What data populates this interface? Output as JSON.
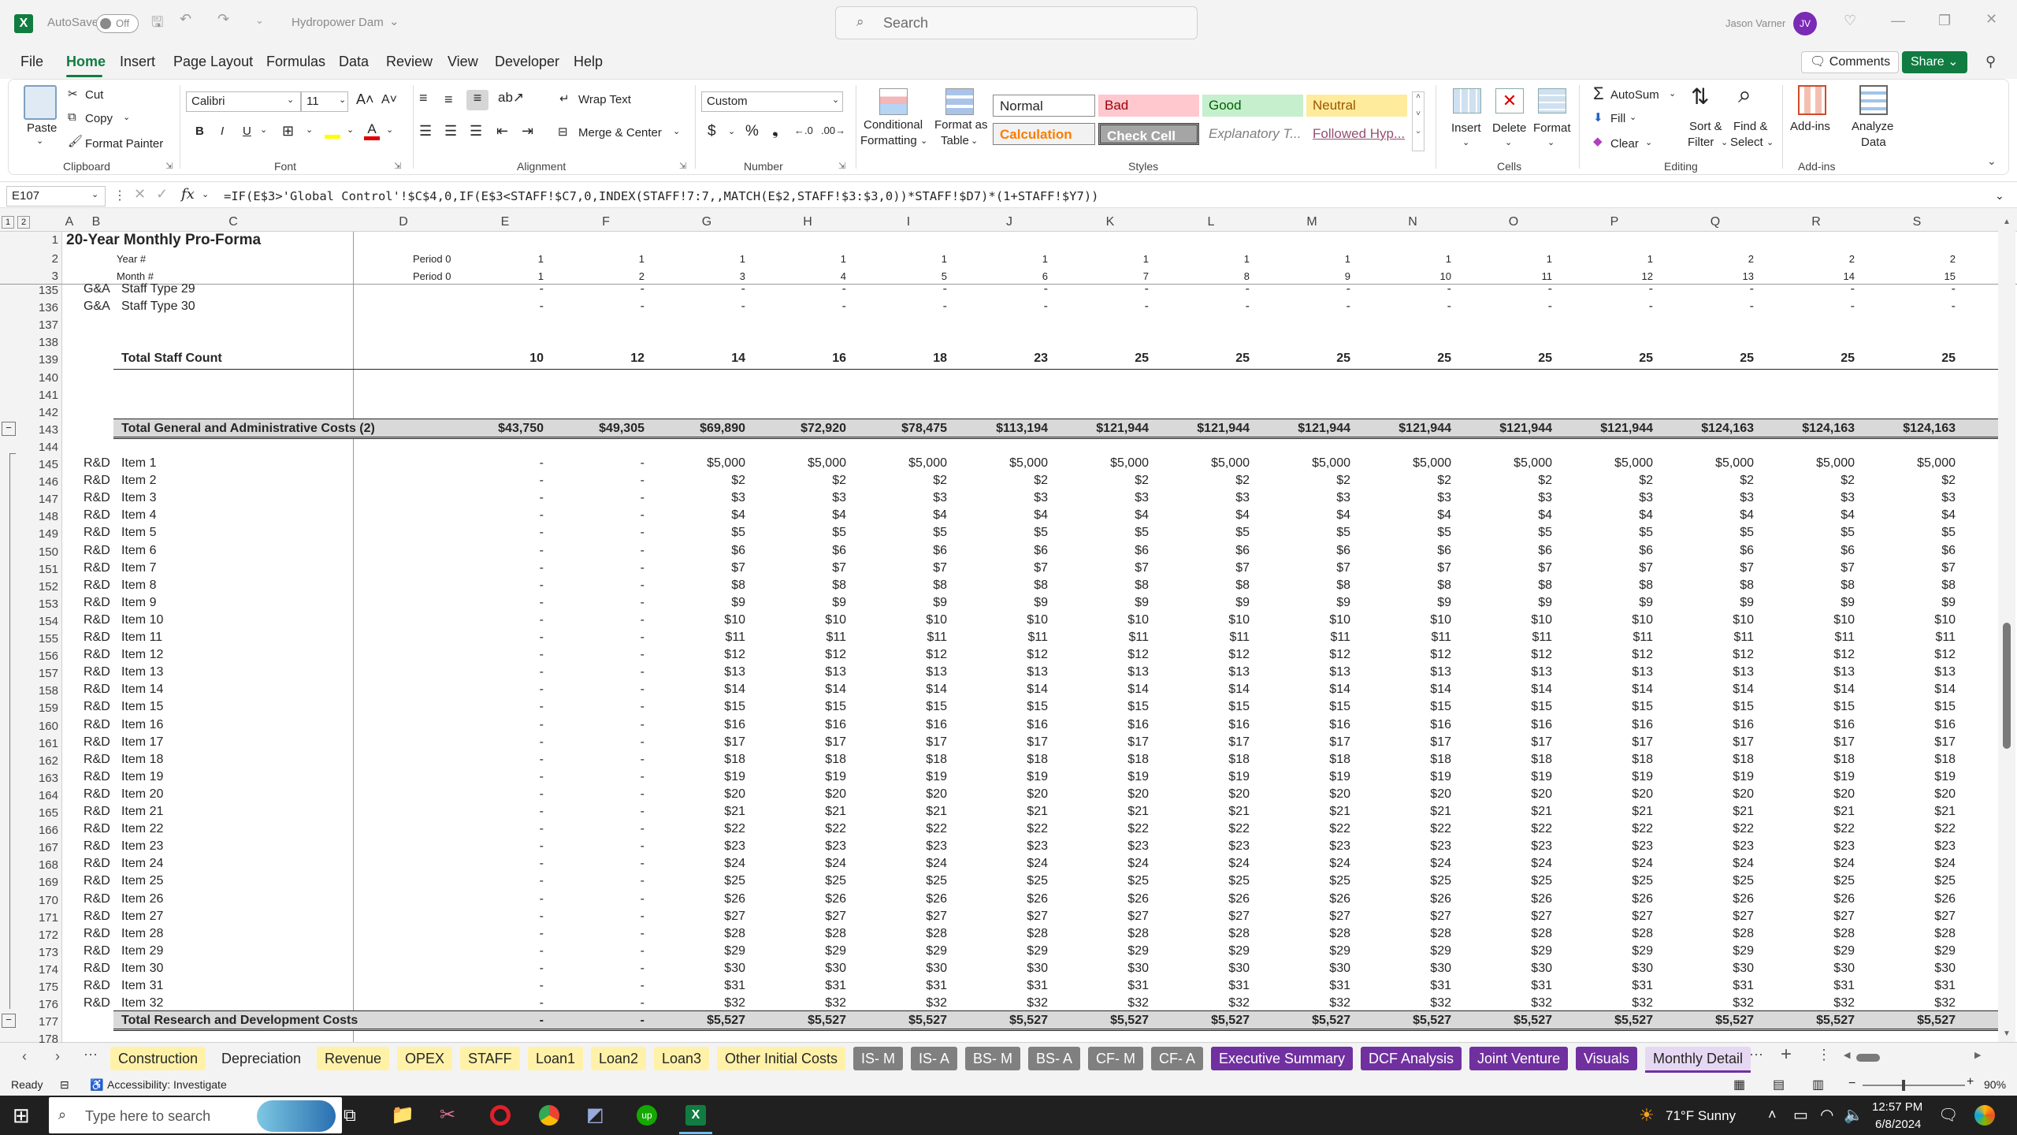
{
  "titlebar": {
    "autosave_label": "AutoSave",
    "autosave_state": "Off",
    "document_title": "Hydropower Dam",
    "search_placeholder": "Search",
    "user_name": "Jason Varner",
    "user_initials": "JV"
  },
  "menu": {
    "file": "File",
    "home": "Home",
    "insert": "Insert",
    "page_layout": "Page Layout",
    "formulas": "Formulas",
    "data": "Data",
    "review": "Review",
    "view": "View",
    "developer": "Developer",
    "help": "Help",
    "comments": "Comments",
    "share": "Share"
  },
  "ribbon": {
    "clipboard": {
      "paste": "Paste",
      "cut": "Cut",
      "copy": "Copy",
      "format_painter": "Format Painter",
      "label": "Clipboard"
    },
    "font": {
      "name": "Calibri",
      "size": "11",
      "label": "Font"
    },
    "alignment": {
      "wrap_text": "Wrap Text",
      "merge_center": "Merge & Center",
      "label": "Alignment"
    },
    "number": {
      "format": "Custom",
      "label": "Number"
    },
    "styles": {
      "conditional_formatting_1": "Conditional",
      "conditional_formatting_2": "Formatting",
      "format_as_table_1": "Format as",
      "format_as_table_2": "Table",
      "normal": "Normal",
      "bad": "Bad",
      "good": "Good",
      "neutral": "Neutral",
      "calculation": "Calculation",
      "check_cell": "Check Cell",
      "explanatory": "Explanatory T...",
      "followed": "Followed Hyp...",
      "label": "Styles"
    },
    "cells": {
      "insert": "Insert",
      "delete": "Delete",
      "format": "Format",
      "label": "Cells"
    },
    "editing": {
      "autosum": "AutoSum",
      "fill": "Fill",
      "clear": "Clear",
      "sort_filter_1": "Sort &",
      "sort_filter_2": "Filter",
      "find_select_1": "Find &",
      "find_select_2": "Select",
      "label": "Editing"
    },
    "addins": {
      "addins": "Add-ins",
      "analyze_1": "Analyze",
      "analyze_2": "Data",
      "label": "Add-ins"
    }
  },
  "formula_bar": {
    "name_box": "E107",
    "formula": "=IF(E$3>'Global Control'!$C$4,0,IF(E$3<STAFF!$C7,0,INDEX(STAFF!7:7,,MATCH(E$2,STAFF!$3:$3,0))*STAFF!$D7)*(1+STAFF!$Y7))"
  },
  "grid": {
    "columns": [
      "A",
      "B",
      "C",
      "D",
      "E",
      "F",
      "G",
      "H",
      "I",
      "J",
      "K",
      "L",
      "M",
      "N",
      "O",
      "P",
      "Q",
      "R",
      "S"
    ],
    "title": "20-Year Monthly Pro-Forma",
    "year_label": "Year #",
    "month_label": "Month #",
    "period0": "Period 0",
    "year_values": [
      "1",
      "1",
      "1",
      "1",
      "1",
      "1",
      "1",
      "1",
      "1",
      "1",
      "1",
      "1",
      "2",
      "2",
      "2"
    ],
    "month_values": [
      "1",
      "2",
      "3",
      "4",
      "5",
      "6",
      "7",
      "8",
      "9",
      "10",
      "11",
      "12",
      "13",
      "14",
      "15"
    ],
    "staff_rows": [
      {
        "row": "135",
        "b": "G&A",
        "c": "Staff Type 29"
      },
      {
        "row": "136",
        "b": "G&A",
        "c": "Staff Type 30"
      }
    ],
    "dash": "-",
    "row137": "137",
    "row138": "138",
    "row140": "140",
    "row141": "141",
    "row142": "142",
    "row144": "144",
    "row178": "178",
    "staff_total": {
      "row": "139",
      "label": "Total Staff Count",
      "values": [
        "10",
        "12",
        "14",
        "16",
        "18",
        "23",
        "25",
        "25",
        "25",
        "25",
        "25",
        "25",
        "25",
        "25",
        "25"
      ]
    },
    "ga_total": {
      "row": "143",
      "label": "Total General and Administrative Costs (2)",
      "values": [
        "$43,750",
        "$49,305",
        "$69,890",
        "$72,920",
        "$78,475",
        "$113,194",
        "$121,944",
        "$121,944",
        "$121,944",
        "$121,944",
        "$121,944",
        "$121,944",
        "$124,163",
        "$124,163",
        "$124,163"
      ]
    },
    "rd_items": [
      {
        "row": "145",
        "label": "Item 1",
        "value": "$5,000"
      },
      {
        "row": "146",
        "label": "Item 2",
        "value": "$2"
      },
      {
        "row": "147",
        "label": "Item 3",
        "value": "$3"
      },
      {
        "row": "148",
        "label": "Item 4",
        "value": "$4"
      },
      {
        "row": "149",
        "label": "Item 5",
        "value": "$5"
      },
      {
        "row": "150",
        "label": "Item 6",
        "value": "$6"
      },
      {
        "row": "151",
        "label": "Item 7",
        "value": "$7"
      },
      {
        "row": "152",
        "label": "Item 8",
        "value": "$8"
      },
      {
        "row": "153",
        "label": "Item 9",
        "value": "$9"
      },
      {
        "row": "154",
        "label": "Item 10",
        "value": "$10"
      },
      {
        "row": "155",
        "label": "Item 11",
        "value": "$11"
      },
      {
        "row": "156",
        "label": "Item 12",
        "value": "$12"
      },
      {
        "row": "157",
        "label": "Item 13",
        "value": "$13"
      },
      {
        "row": "158",
        "label": "Item 14",
        "value": "$14"
      },
      {
        "row": "159",
        "label": "Item 15",
        "value": "$15"
      },
      {
        "row": "160",
        "label": "Item 16",
        "value": "$16"
      },
      {
        "row": "161",
        "label": "Item 17",
        "value": "$17"
      },
      {
        "row": "162",
        "label": "Item 18",
        "value": "$18"
      },
      {
        "row": "163",
        "label": "Item 19",
        "value": "$19"
      },
      {
        "row": "164",
        "label": "Item 20",
        "value": "$20"
      },
      {
        "row": "165",
        "label": "Item 21",
        "value": "$21"
      },
      {
        "row": "166",
        "label": "Item 22",
        "value": "$22"
      },
      {
        "row": "167",
        "label": "Item 23",
        "value": "$23"
      },
      {
        "row": "168",
        "label": "Item 24",
        "value": "$24"
      },
      {
        "row": "169",
        "label": "Item 25",
        "value": "$25"
      },
      {
        "row": "170",
        "label": "Item 26",
        "value": "$26"
      },
      {
        "row": "171",
        "label": "Item 27",
        "value": "$27"
      },
      {
        "row": "172",
        "label": "Item 28",
        "value": "$28"
      },
      {
        "row": "173",
        "label": "Item 29",
        "value": "$29"
      },
      {
        "row": "174",
        "label": "Item 30",
        "value": "$30"
      },
      {
        "row": "175",
        "label": "Item 31",
        "value": "$31"
      },
      {
        "row": "176",
        "label": "Item 32",
        "value": "$32"
      }
    ],
    "rd_dept": "R&D",
    "rd_total": {
      "row": "177",
      "label": "Total Research and Development Costs",
      "value": "$5,527"
    }
  },
  "sheet_tabs": [
    {
      "label": "Construction",
      "bg": "#fff2a8",
      "fg": "#262626"
    },
    {
      "label": "Depreciation",
      "bg": "#f3f3f3",
      "fg": "#262626"
    },
    {
      "label": "Revenue",
      "bg": "#fff2a8",
      "fg": "#262626"
    },
    {
      "label": "OPEX",
      "bg": "#fff2a8",
      "fg": "#262626"
    },
    {
      "label": "STAFF",
      "bg": "#fff2a8",
      "fg": "#262626"
    },
    {
      "label": "Loan1",
      "bg": "#fff2a8",
      "fg": "#262626"
    },
    {
      "label": "Loan2",
      "bg": "#fff2a8",
      "fg": "#262626"
    },
    {
      "label": "Loan3",
      "bg": "#fff2a8",
      "fg": "#262626"
    },
    {
      "label": "Other Initial Costs",
      "bg": "#fff2a8",
      "fg": "#262626"
    },
    {
      "label": "IS- M",
      "bg": "#808080",
      "fg": "#ffffff"
    },
    {
      "label": "IS- A",
      "bg": "#808080",
      "fg": "#ffffff"
    },
    {
      "label": "BS- M",
      "bg": "#808080",
      "fg": "#ffffff"
    },
    {
      "label": "BS- A",
      "bg": "#808080",
      "fg": "#ffffff"
    },
    {
      "label": "CF- M",
      "bg": "#808080",
      "fg": "#ffffff"
    },
    {
      "label": "CF- A",
      "bg": "#808080",
      "fg": "#ffffff"
    },
    {
      "label": "Executive Summary",
      "bg": "#7030a0",
      "fg": "#ffffff"
    },
    {
      "label": "DCF Analysis",
      "bg": "#7030a0",
      "fg": "#ffffff"
    },
    {
      "label": "Joint Venture",
      "bg": "#7030a0",
      "fg": "#ffffff"
    },
    {
      "label": "Visuals",
      "bg": "#7030a0",
      "fg": "#ffffff"
    },
    {
      "label": "Monthly Detail",
      "bg": "#e6d8f2",
      "fg": "#262626"
    }
  ],
  "status": {
    "ready": "Ready",
    "accessibility": "Accessibility: Investigate",
    "zoom": "90%"
  },
  "taskbar": {
    "search_placeholder": "Type here to search",
    "weather": "71°F  Sunny",
    "time": "12:57 PM",
    "date": "6/8/2024"
  }
}
